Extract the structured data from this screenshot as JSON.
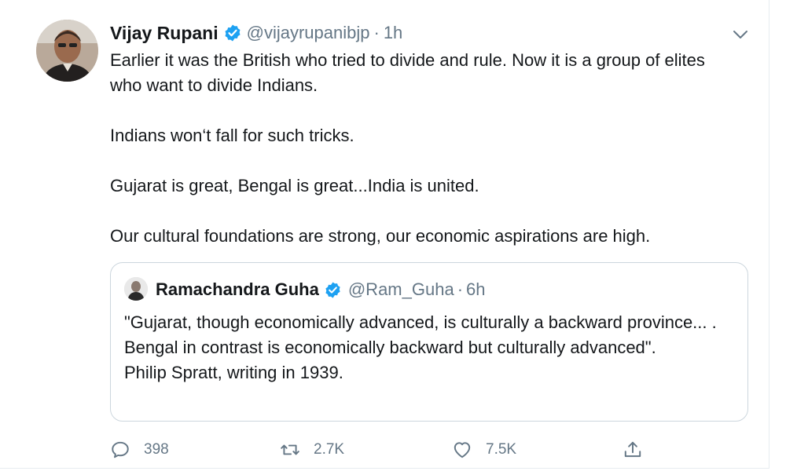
{
  "tweet": {
    "author": {
      "display_name": "Vijay Rupani",
      "handle": "@vijayrupanibjp",
      "separator": "·",
      "time": "1h",
      "verified": true,
      "avatar_icon": "avatar-photo"
    },
    "body": [
      "Earlier it was the British who tried to divide and rule. Now it is a group of elites who want to divide Indians.",
      "Indians won‘t fall for such tricks.",
      "Gujarat is great, Bengal is great...India is united.",
      "Our cultural foundations are strong, our economic aspirations are high."
    ],
    "quoted": {
      "display_name": "Ramachandra Guha",
      "handle": "@Ram_Guha",
      "separator": "·",
      "time": "6h",
      "verified": true,
      "lines": [
        "\"Gujarat, though economically advanced, is culturally a backward province... . Bengal in contrast is economically backward but culturally advanced\".",
        "Philip Spratt, writing in 1939."
      ]
    },
    "actions": {
      "reply": {
        "icon": "reply-icon",
        "count": "398"
      },
      "retweet": {
        "icon": "retweet-icon",
        "count": "2.7K"
      },
      "like": {
        "icon": "like-icon",
        "count": "7.5K"
      },
      "share": {
        "icon": "share-icon"
      }
    },
    "colors": {
      "text": "#14171a",
      "secondary": "#657786",
      "verified_badge": "#1da1f2",
      "border": "#ccd6dd"
    }
  }
}
